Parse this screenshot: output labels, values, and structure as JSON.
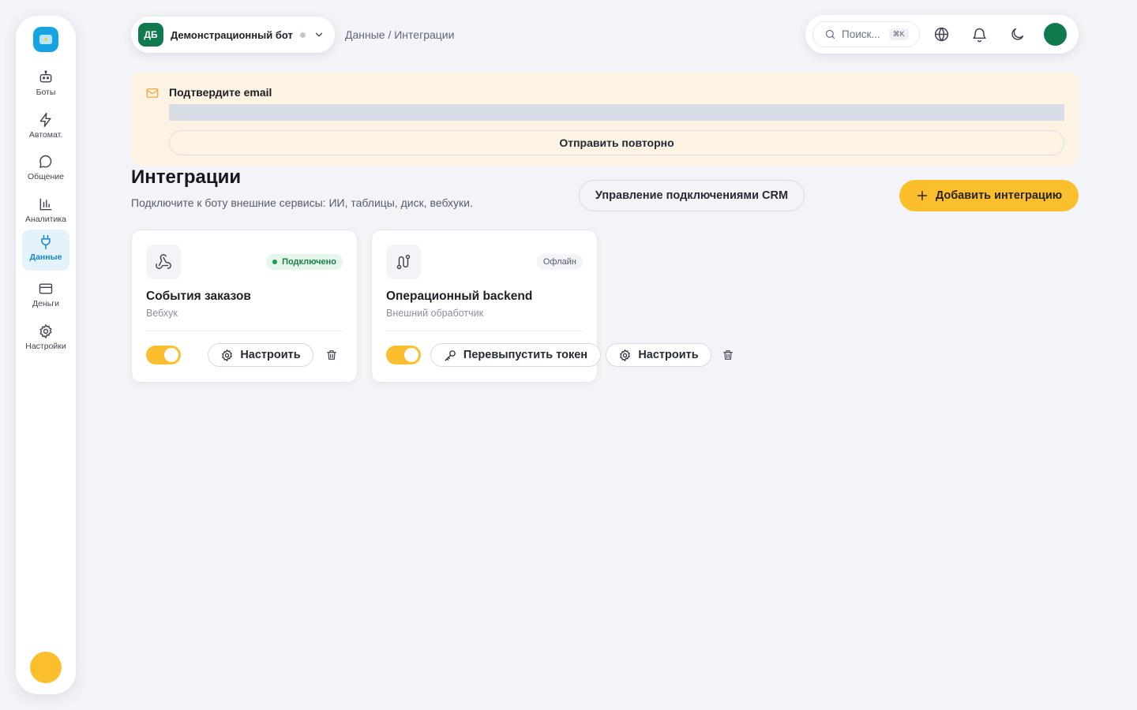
{
  "sidebar": {
    "logo_icon": "bot-logo-icon",
    "items": [
      {
        "label": "Боты",
        "icon": "bot-icon"
      },
      {
        "label": "Автомат.",
        "icon": "lightning-icon"
      },
      {
        "label": "Общение",
        "icon": "chat-icon"
      },
      {
        "label": "Аналитика",
        "icon": "bar-chart-icon"
      },
      {
        "label": "Данные",
        "icon": "plug-icon",
        "active": true
      },
      {
        "label": "Деньги",
        "icon": "card-icon"
      },
      {
        "label": "Настройки",
        "icon": "gear-icon"
      }
    ],
    "user_color": "#fbbf2d"
  },
  "topbar": {
    "bot_initials": "ДБ",
    "bot_name": "Демонстрационный бот",
    "breadcrumb": "Данные / Интеграции",
    "search_placeholder": "Поиск...",
    "search_shortcut": "⌘K",
    "accent_color": "#0f7a4e"
  },
  "banner": {
    "title": "Подтвердите email",
    "resend_label": "Отправить повторно"
  },
  "page": {
    "title": "Интеграции",
    "subtitle": "Подключите к боту внешние сервисы: ИИ, таблицы, диск, вебхуки.",
    "crm_button": "Управление подключениями CRM",
    "add_button": "Добавить интеграцию",
    "accent": "#fbbf2d"
  },
  "integrations": [
    {
      "name": "События заказов",
      "type": "Вебхук",
      "status": "Подключено",
      "icon": "webhook-icon",
      "enabled": true,
      "configure_label": "Настроить"
    },
    {
      "name": "Операционный backend",
      "type": "Внешний обработчик",
      "status": "Офлайн",
      "icon": "route-icon",
      "enabled": true,
      "reissue_label": "Перевыпустить токен",
      "configure_label": "Настроить"
    }
  ]
}
